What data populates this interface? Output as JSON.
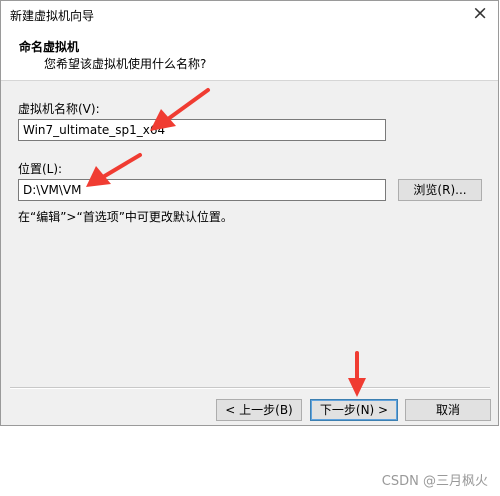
{
  "window": {
    "title": "新建虚拟机向导",
    "close_glyph": "×"
  },
  "header": {
    "title": "命名虚拟机",
    "subtitle": "您希望该虚拟机使用什么名称?"
  },
  "form": {
    "name_label": "虚拟机名称(V):",
    "name_value": "Win7_ultimate_sp1_x64",
    "location_label": "位置(L):",
    "location_value": "D:\\VM\\VM",
    "browse_label": "浏览(R)...",
    "hint": "在“编辑”>“首选项”中可更改默认位置。"
  },
  "footer": {
    "back_label": "< 上一步(B)",
    "next_label": "下一步(N) >",
    "cancel_label": "取消"
  },
  "watermark": "CSDN @三月枫火",
  "colors": {
    "annotation_arrow": "#f03c32"
  }
}
